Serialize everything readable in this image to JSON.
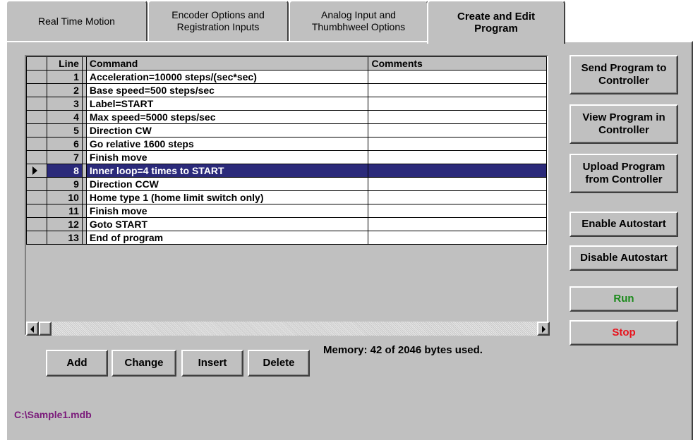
{
  "tabs": [
    {
      "label": "Real Time Motion"
    },
    {
      "label": "Encoder Options and\nRegistration Inputs"
    },
    {
      "label": "Analog Input and\nThumbhweel Options"
    },
    {
      "label": "Create and Edit\nProgram"
    }
  ],
  "grid": {
    "headers": {
      "line": "Line",
      "command": "Command",
      "comments": "Comments"
    },
    "selected_line": "8",
    "rows": [
      {
        "line": "1",
        "command": "Acceleration=10000 steps/(sec*sec)",
        "comments": ""
      },
      {
        "line": "2",
        "command": "Base speed=500 steps/sec",
        "comments": ""
      },
      {
        "line": "3",
        "command": "Label=START",
        "comments": ""
      },
      {
        "line": "4",
        "command": "Max speed=5000 steps/sec",
        "comments": ""
      },
      {
        "line": "5",
        "command": "Direction CW",
        "comments": ""
      },
      {
        "line": "6",
        "command": "Go relative 1600 steps",
        "comments": ""
      },
      {
        "line": "7",
        "command": "Finish move",
        "comments": ""
      },
      {
        "line": "8",
        "command": "Inner loop=4 times to START",
        "comments": ""
      },
      {
        "line": "9",
        "command": "Direction CCW",
        "comments": ""
      },
      {
        "line": "10",
        "command": "Home type 1 (home limit switch only)",
        "comments": ""
      },
      {
        "line": "11",
        "command": "Finish move",
        "comments": ""
      },
      {
        "line": "12",
        "command": "Goto START",
        "comments": ""
      },
      {
        "line": "13",
        "command": "End of program",
        "comments": ""
      }
    ]
  },
  "buttons": {
    "send": "Send Program to\nController",
    "view": "View Program in\nController",
    "upload": "Upload Program\nfrom Controller",
    "enable_autostart": "Enable Autostart",
    "disable_autostart": "Disable Autostart",
    "run": "Run",
    "stop": "Stop",
    "add": "Add",
    "change": "Change",
    "insert": "Insert",
    "delete": "Delete"
  },
  "memory_text": "Memory: 42 of 2046 bytes used.",
  "status_path": "C:\\Sample1.mdb",
  "colors": {
    "run": "#1a8a1a",
    "stop": "#e8121c",
    "selection": "#2b2a7a",
    "status": "#7a1a7a"
  }
}
